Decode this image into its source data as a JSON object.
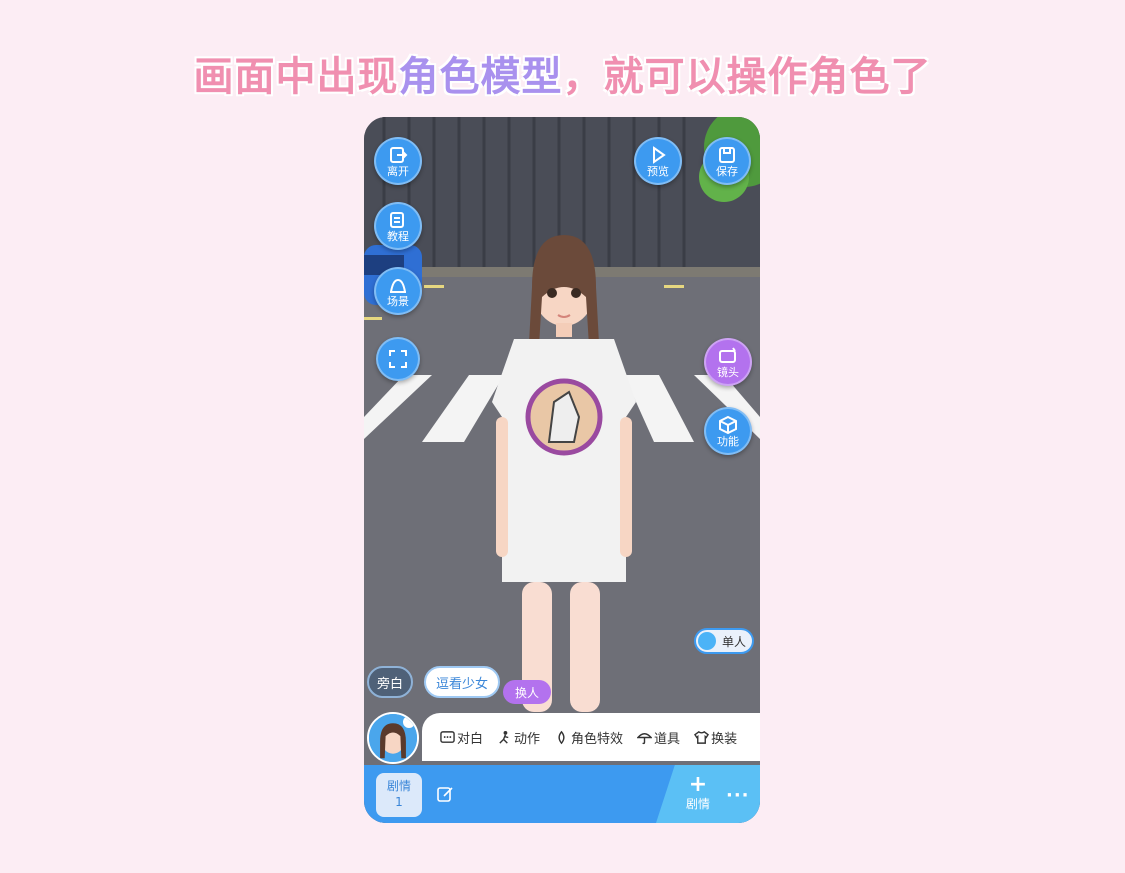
{
  "caption": {
    "part1": "画面中出现",
    "part2": "角色模型",
    "part3": "，就可以操作角色了"
  },
  "colors": {
    "accent": "#3d9af0",
    "purple": "#b372ee",
    "caption_pink": "#f08fb0",
    "caption_purple": "#a991ee"
  },
  "left_buttons": [
    {
      "label": "离开",
      "icon": "exit-icon"
    },
    {
      "label": "教程",
      "icon": "tutorial-icon"
    },
    {
      "label": "场景",
      "icon": "scene-icon"
    },
    {
      "label": "",
      "icon": "fullscreen-icon"
    }
  ],
  "right_buttons": [
    {
      "label": "预览",
      "icon": "play-icon"
    },
    {
      "label": "保存",
      "icon": "save-icon"
    },
    {
      "label": "镜头",
      "icon": "camera-icon"
    },
    {
      "label": "功能",
      "icon": "cube-icon"
    }
  ],
  "toggle": {
    "label": "单人",
    "state": "on"
  },
  "pills": {
    "narration": "旁白",
    "character": "逗看少女",
    "swap": "换人"
  },
  "tools": [
    {
      "label": "对白",
      "icon": "dialogue-icon"
    },
    {
      "label": "动作",
      "icon": "action-icon"
    },
    {
      "label": "角色特效",
      "icon": "effect-icon"
    },
    {
      "label": "道具",
      "icon": "umbrella-icon"
    },
    {
      "label": "换装",
      "icon": "shirt-icon"
    }
  ],
  "bottom": {
    "episode_label": "剧情",
    "episode_number": "1",
    "add_label": "剧情",
    "more": "···"
  }
}
